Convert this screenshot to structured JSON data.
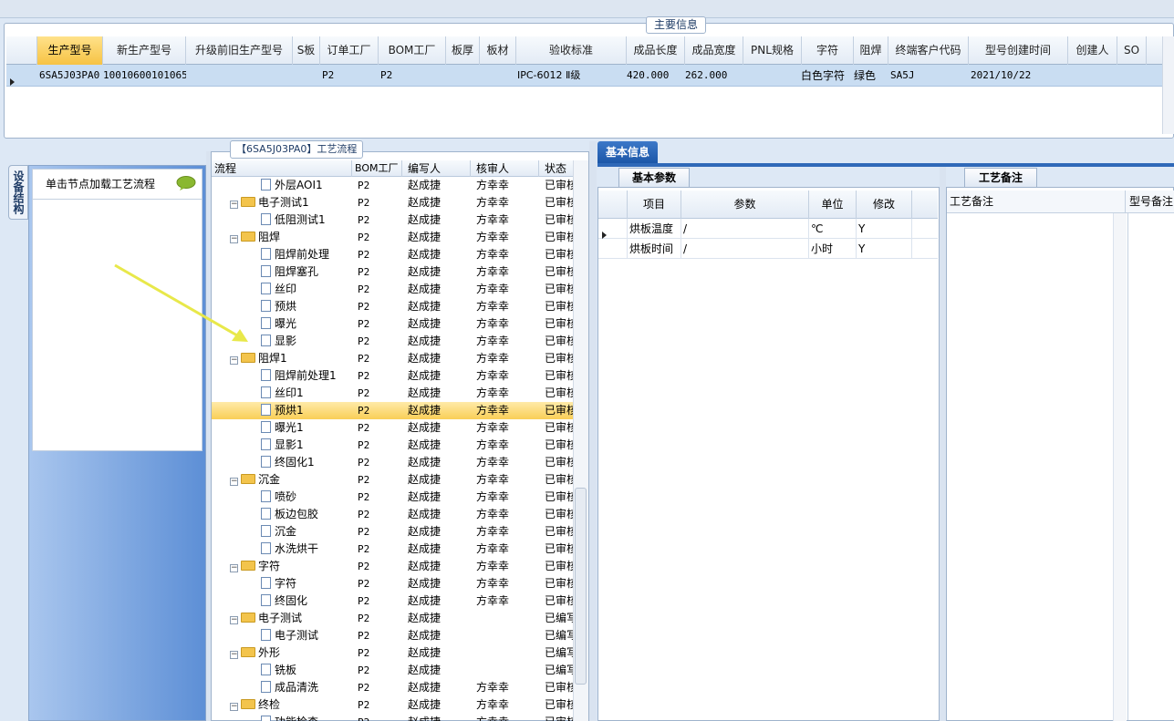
{
  "main_info": {
    "title": "主要信息",
    "columns": [
      "生产型号",
      "新生产型号",
      "升级前旧生产型号",
      "S板",
      "订单工厂",
      "BOM工厂",
      "板厚",
      "板材",
      "验收标准",
      "成品长度",
      "成品宽度",
      "PNL规格",
      "字符",
      "阻焊",
      "终端客户代码",
      "型号创建时间",
      "创建人",
      "SO"
    ],
    "row": [
      "6SA5J03PA0",
      "10010600101065",
      "",
      "",
      "P2",
      "P2",
      "",
      "",
      "IPC-6012 Ⅱ级",
      "420.000",
      "262.000",
      "",
      "白色字符",
      "绿色",
      "SA5J",
      "2021/10/22",
      "",
      ""
    ]
  },
  "left_panel": {
    "tab": "设备结构",
    "hint": "单击节点加载工艺流程"
  },
  "process_tree": {
    "title": "【6SA5J03PA0】工艺流程",
    "columns": [
      "流程",
      "BOM工厂",
      "编写人",
      "核审人",
      "状态"
    ],
    "rows": [
      {
        "level": 1,
        "type": "doc",
        "name": "外层AOI1",
        "bom": "P2",
        "writer": "赵成捷",
        "reviewer": "方幸幸",
        "status": "已审核",
        "selected": false
      },
      {
        "level": 0,
        "type": "folder",
        "name": "电子测试1",
        "bom": "P2",
        "writer": "赵成捷",
        "reviewer": "方幸幸",
        "status": "已审核",
        "selected": false
      },
      {
        "level": 1,
        "type": "doc",
        "name": "低阻测试1",
        "bom": "P2",
        "writer": "赵成捷",
        "reviewer": "方幸幸",
        "status": "已审核",
        "selected": false
      },
      {
        "level": 0,
        "type": "folder",
        "name": "阻焊",
        "bom": "P2",
        "writer": "赵成捷",
        "reviewer": "方幸幸",
        "status": "已审核",
        "selected": false
      },
      {
        "level": 1,
        "type": "doc",
        "name": "阻焊前处理",
        "bom": "P2",
        "writer": "赵成捷",
        "reviewer": "方幸幸",
        "status": "已审核",
        "selected": false
      },
      {
        "level": 1,
        "type": "doc",
        "name": "阻焊塞孔",
        "bom": "P2",
        "writer": "赵成捷",
        "reviewer": "方幸幸",
        "status": "已审核",
        "selected": false
      },
      {
        "level": 1,
        "type": "doc",
        "name": "丝印",
        "bom": "P2",
        "writer": "赵成捷",
        "reviewer": "方幸幸",
        "status": "已审核",
        "selected": false
      },
      {
        "level": 1,
        "type": "doc",
        "name": "预烘",
        "bom": "P2",
        "writer": "赵成捷",
        "reviewer": "方幸幸",
        "status": "已审核",
        "selected": false
      },
      {
        "level": 1,
        "type": "doc",
        "name": "曝光",
        "bom": "P2",
        "writer": "赵成捷",
        "reviewer": "方幸幸",
        "status": "已审核",
        "selected": false
      },
      {
        "level": 1,
        "type": "doc",
        "name": "显影",
        "bom": "P2",
        "writer": "赵成捷",
        "reviewer": "方幸幸",
        "status": "已审核",
        "selected": false
      },
      {
        "level": 0,
        "type": "folder",
        "name": "阻焊1",
        "bom": "P2",
        "writer": "赵成捷",
        "reviewer": "方幸幸",
        "status": "已审核",
        "selected": false
      },
      {
        "level": 1,
        "type": "doc",
        "name": "阻焊前处理1",
        "bom": "P2",
        "writer": "赵成捷",
        "reviewer": "方幸幸",
        "status": "已审核",
        "selected": false
      },
      {
        "level": 1,
        "type": "doc",
        "name": "丝印1",
        "bom": "P2",
        "writer": "赵成捷",
        "reviewer": "方幸幸",
        "status": "已审核",
        "selected": false
      },
      {
        "level": 1,
        "type": "doc",
        "name": "预烘1",
        "bom": "P2",
        "writer": "赵成捷",
        "reviewer": "方幸幸",
        "status": "已审核",
        "selected": true
      },
      {
        "level": 1,
        "type": "doc",
        "name": "曝光1",
        "bom": "P2",
        "writer": "赵成捷",
        "reviewer": "方幸幸",
        "status": "已审核",
        "selected": false
      },
      {
        "level": 1,
        "type": "doc",
        "name": "显影1",
        "bom": "P2",
        "writer": "赵成捷",
        "reviewer": "方幸幸",
        "status": "已审核",
        "selected": false
      },
      {
        "level": 1,
        "type": "doc",
        "name": "终固化1",
        "bom": "P2",
        "writer": "赵成捷",
        "reviewer": "方幸幸",
        "status": "已审核",
        "selected": false
      },
      {
        "level": 0,
        "type": "folder",
        "name": "沉金",
        "bom": "P2",
        "writer": "赵成捷",
        "reviewer": "方幸幸",
        "status": "已审核",
        "selected": false
      },
      {
        "level": 1,
        "type": "doc",
        "name": "喷砂",
        "bom": "P2",
        "writer": "赵成捷",
        "reviewer": "方幸幸",
        "status": "已审核",
        "selected": false
      },
      {
        "level": 1,
        "type": "doc",
        "name": "板边包胶",
        "bom": "P2",
        "writer": "赵成捷",
        "reviewer": "方幸幸",
        "status": "已审核",
        "selected": false
      },
      {
        "level": 1,
        "type": "doc",
        "name": "沉金",
        "bom": "P2",
        "writer": "赵成捷",
        "reviewer": "方幸幸",
        "status": "已审核",
        "selected": false
      },
      {
        "level": 1,
        "type": "doc",
        "name": "水洗烘干",
        "bom": "P2",
        "writer": "赵成捷",
        "reviewer": "方幸幸",
        "status": "已审核",
        "selected": false
      },
      {
        "level": 0,
        "type": "folder",
        "name": "字符",
        "bom": "P2",
        "writer": "赵成捷",
        "reviewer": "方幸幸",
        "status": "已审核",
        "selected": false
      },
      {
        "level": 1,
        "type": "doc",
        "name": "字符",
        "bom": "P2",
        "writer": "赵成捷",
        "reviewer": "方幸幸",
        "status": "已审核",
        "selected": false
      },
      {
        "level": 1,
        "type": "doc",
        "name": "终固化",
        "bom": "P2",
        "writer": "赵成捷",
        "reviewer": "方幸幸",
        "status": "已审核",
        "selected": false
      },
      {
        "level": 0,
        "type": "folder",
        "name": "电子测试",
        "bom": "P2",
        "writer": "赵成捷",
        "reviewer": "",
        "status": "已编写",
        "selected": false
      },
      {
        "level": 1,
        "type": "doc",
        "name": "电子测试",
        "bom": "P2",
        "writer": "赵成捷",
        "reviewer": "",
        "status": "已编写",
        "selected": false
      },
      {
        "level": 0,
        "type": "folder",
        "name": "外形",
        "bom": "P2",
        "writer": "赵成捷",
        "reviewer": "",
        "status": "已编写",
        "selected": false
      },
      {
        "level": 1,
        "type": "doc",
        "name": "铣板",
        "bom": "P2",
        "writer": "赵成捷",
        "reviewer": "",
        "status": "已编写",
        "selected": false
      },
      {
        "level": 1,
        "type": "doc",
        "name": "成品清洗",
        "bom": "P2",
        "writer": "赵成捷",
        "reviewer": "方幸幸",
        "status": "已审核",
        "selected": false
      },
      {
        "level": 0,
        "type": "folder",
        "name": "终检",
        "bom": "P2",
        "writer": "赵成捷",
        "reviewer": "方幸幸",
        "status": "已审核",
        "selected": false
      },
      {
        "level": 1,
        "type": "doc",
        "name": "功能检查",
        "bom": "P2",
        "writer": "赵成捷",
        "reviewer": "方幸幸",
        "status": "已审核",
        "selected": false
      }
    ]
  },
  "basic_info": {
    "tab": "基本信息",
    "sub_tab": "基本参数",
    "columns": [
      "项目",
      "参数",
      "单位",
      "修改"
    ],
    "rows": [
      {
        "item": "烘板温度",
        "param": "/",
        "unit": "℃",
        "modify": "Y"
      },
      {
        "item": "烘板时间",
        "param": "/",
        "unit": "小时",
        "modify": "Y"
      }
    ]
  },
  "process_remark": {
    "tab": "工艺备注",
    "columns": [
      "工艺备注",
      "型号备注"
    ]
  },
  "colors": {
    "selected_row": "#f9cf57",
    "header_selected": "#f6c344",
    "tab_active": "#1c57a8",
    "arrow": "#e8e84a"
  }
}
